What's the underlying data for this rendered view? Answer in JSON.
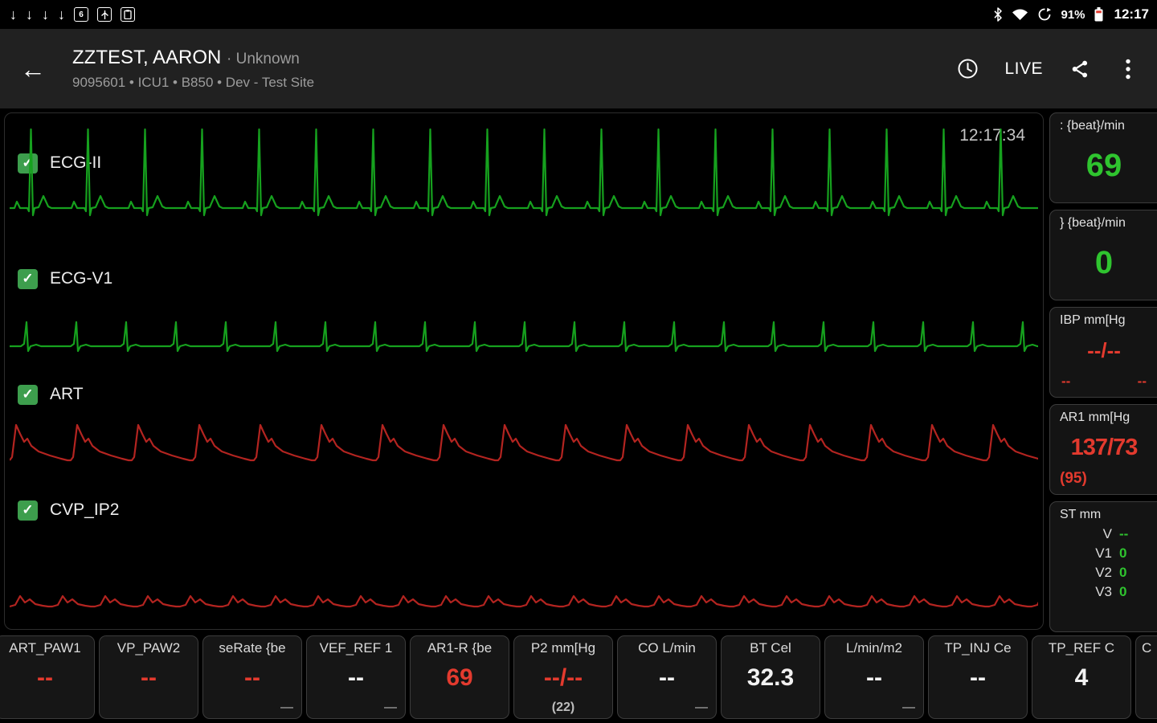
{
  "colors": {
    "ecg_green": "#16a11e",
    "trace_red": "#b32420",
    "value_green": "#2fc42f",
    "value_red": "#e33a2e",
    "value_white": "#f2f2f2"
  },
  "icons": {
    "download_arrow": "↓",
    "back_arrow": "←",
    "checkmark": "✓",
    "notification_badge": "6"
  },
  "status_bar": {
    "battery_percent": "91%",
    "time": "12:17"
  },
  "header": {
    "patient_name": "ZZTEST, AARON",
    "name_separator": "·",
    "patient_status": "Unknown",
    "patient_details": "9095601 • ICU1 • B850 • Dev - Test Site",
    "live_label": "LIVE"
  },
  "monitor": {
    "timestamp": "12:17:34",
    "channels": [
      {
        "label": "ECG-II",
        "checked": true,
        "color": "#16a11e"
      },
      {
        "label": "ECG-V1",
        "checked": true,
        "color": "#16a11e"
      },
      {
        "label": "ART",
        "checked": true,
        "color": "#b32420"
      },
      {
        "label": "CVP_IP2",
        "checked": true,
        "color": "#b32420"
      }
    ]
  },
  "vitals": [
    {
      "label": ": {beat}/min",
      "value": "69",
      "color": "#2fc42f"
    },
    {
      "label": "} {beat}/min",
      "value": "0",
      "color": "#2fc42f"
    },
    {
      "label": "IBP mm[Hg",
      "value": "--/--",
      "sub_left": "--",
      "sub_right": "--",
      "color": "#e33a2e"
    },
    {
      "label": "AR1 mm[Hg",
      "value": "137/73",
      "sub": "(95)",
      "color": "#e33a2e"
    },
    {
      "label": "ST mm",
      "value_color": "#2fc42f",
      "rows": [
        {
          "name": "V",
          "value": "--"
        },
        {
          "name": "V1",
          "value": "0"
        },
        {
          "name": "V2",
          "value": "0"
        },
        {
          "name": "V3",
          "value": "0"
        }
      ]
    }
  ],
  "bottom_tiles": [
    {
      "label": "ART_PAW1",
      "value": "--",
      "color": "#e33a2e"
    },
    {
      "label": "VP_PAW2",
      "value": "--",
      "color": "#e33a2e"
    },
    {
      "label": "seRate {be",
      "value": "--",
      "color": "#e33a2e",
      "sub": "—",
      "sub_align": "right"
    },
    {
      "label": "VEF_REF 1",
      "value": "--",
      "color": "#f2f2f2",
      "sub": "—",
      "sub_align": "right"
    },
    {
      "label": "AR1-R {be",
      "value": "69",
      "color": "#e33a2e"
    },
    {
      "label": "P2 mm[Hg",
      "value": "--/--",
      "color": "#e33a2e",
      "sub": "(22)",
      "sub_align": "center",
      "sub_color": "#e33a2e"
    },
    {
      "label": "CO L/min",
      "value": "--",
      "color": "#f2f2f2",
      "sub": "—",
      "sub_align": "right"
    },
    {
      "label": "BT Cel",
      "value": "32.3",
      "color": "#f2f2f2"
    },
    {
      "label": "L/min/m2",
      "value": "--",
      "color": "#f2f2f2",
      "sub": "—",
      "sub_align": "right"
    },
    {
      "label": "TP_INJ Ce",
      "value": "--",
      "color": "#f2f2f2"
    },
    {
      "label": "TP_REF C",
      "value": "4",
      "color": "#f2f2f2"
    },
    {
      "label": "C",
      "value": "",
      "color": "#f2f2f2"
    }
  ]
}
